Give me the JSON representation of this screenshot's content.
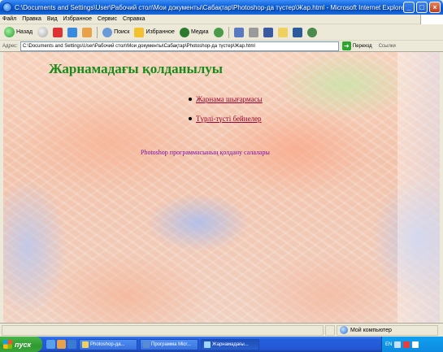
{
  "window": {
    "title": "C:\\Documents and Settings\\User\\Рабочий стол\\Мои документы\\Сабақтар\\Photoshop-да түстер\\Жар.html - Microsoft Internet Explorer",
    "buttons": {
      "minimize": "_",
      "maximize": "□",
      "close": "×"
    }
  },
  "menubar": [
    "Файл",
    "Правка",
    "Вид",
    "Избранное",
    "Сервис",
    "Справка"
  ],
  "toolbar": {
    "back": "Назад",
    "search": "Поиск",
    "favorites": "Избранное",
    "media": "Медиа"
  },
  "address": {
    "label": "Адрес:",
    "value": "C:\\Documents and Settings\\User\\Рабочий стол\\Мои документы\\Сабақтар\\Photoshop-да түстер\\Жар.html",
    "go": "Переход",
    "links": "Ссылки"
  },
  "page": {
    "heading": "Жарнамадағы қолданылуы",
    "menu": [
      "Жарнама шығармасы",
      "Түрлі-түсті бейнелер"
    ],
    "subtitle": "Photoshop программасының қолдану салалары"
  },
  "statusbar": {
    "zone": "Мой компьютер"
  },
  "taskbar": {
    "start": "пуск",
    "tasks": [
      "Photoshop-да...",
      "Программа Micr...",
      "Жарнамадағы..."
    ],
    "clock": "EN"
  },
  "colors": {
    "heading": "#1a8a1a",
    "link": "#9b0030",
    "subtitle": "#7a10a0",
    "title_bar": "#0a5fd8"
  }
}
